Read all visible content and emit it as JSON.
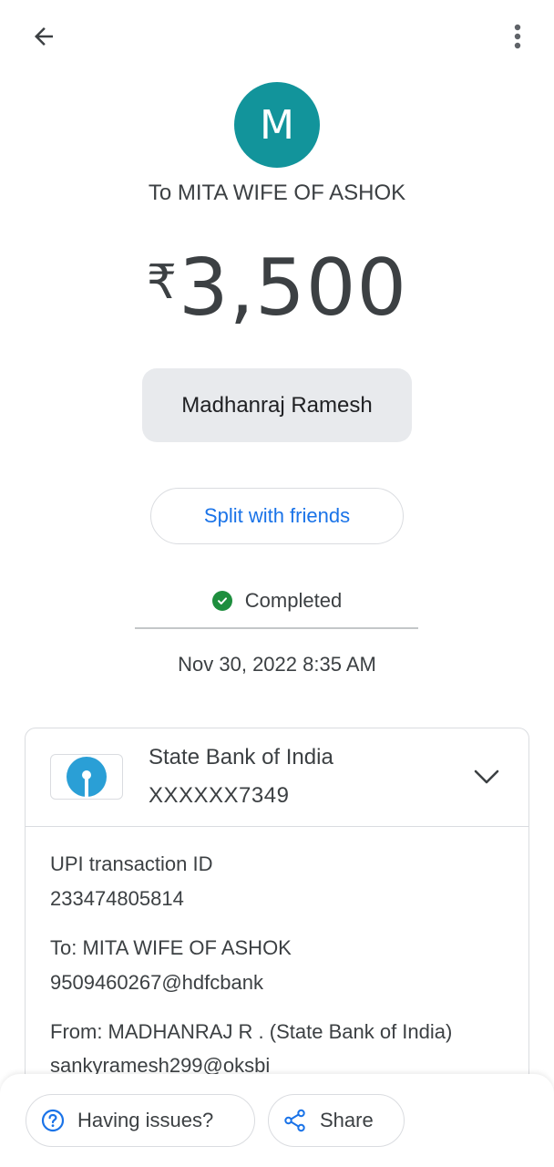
{
  "header": {
    "back_icon": "arrow-left-icon",
    "more_icon": "more-vert-icon"
  },
  "recipient": {
    "avatar_letter": "M",
    "avatar_color": "#12949b",
    "title": "To MITA WIFE OF ASHOK"
  },
  "amount": {
    "currency": "₹",
    "value": "3,500"
  },
  "payer_chip": "Madhanraj Ramesh",
  "split_button": "Split with friends",
  "status": {
    "icon": "check-circle-icon",
    "text": "Completed",
    "color": "#1e8e3e"
  },
  "datetime": "Nov 30, 2022 8:35 AM",
  "bank_card": {
    "bank_name": "State Bank of India",
    "account": "XXXXXX7349",
    "logo_icon": "sbi-logo-icon",
    "logo_color": "#2a9fd6",
    "expand_icon": "chevron-down-icon"
  },
  "details": {
    "txn_label": "UPI transaction ID",
    "txn_id": "233474805814",
    "to_label": "To: MITA WIFE OF ASHOK",
    "to_upi": "9509460267@hdfcbank",
    "from_label": "From: MADHANRAJ R  . (State Bank of India)",
    "from_upi": "sankyramesh299@oksbi"
  },
  "bottom_bar": {
    "issues_label": "Having issues?",
    "issues_icon": "help-circle-icon",
    "share_label": "Share",
    "share_icon": "share-icon",
    "accent": "#1a73e8"
  }
}
